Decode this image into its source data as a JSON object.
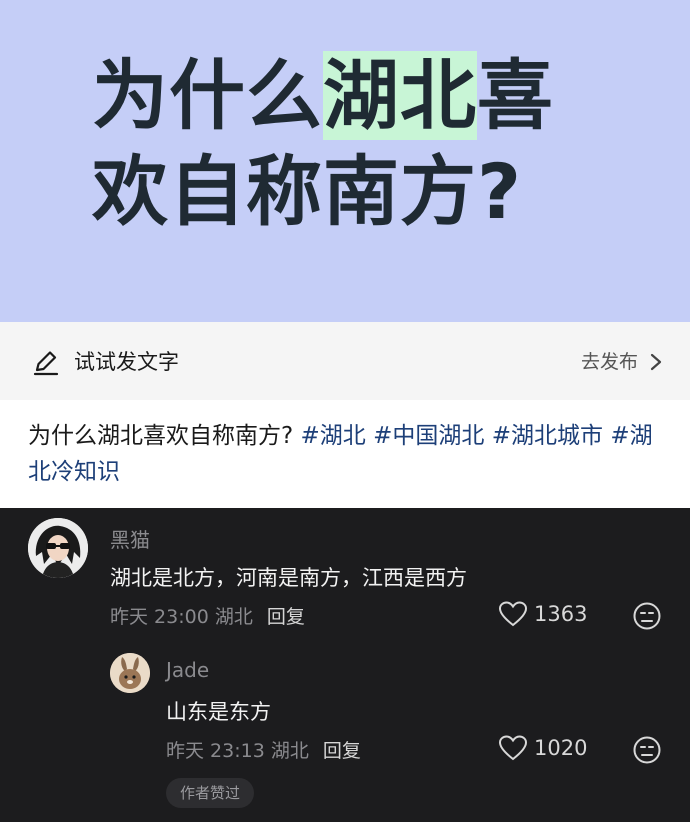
{
  "banner": {
    "title_part1": "为什么",
    "title_highlight": "湖北",
    "title_part2": "喜",
    "title_line2": "欢自称南方?"
  },
  "compose": {
    "label": "试试发文字",
    "publish_label": "去发布"
  },
  "post": {
    "text": "为什么湖北喜欢自称南方? ",
    "tags": [
      "#湖北",
      "#中国湖北",
      "#湖北城市",
      "#湖北冷知识"
    ]
  },
  "comments": [
    {
      "username": "黑猫",
      "text": "湖北是北方，河南是南方，江西是西方",
      "meta": "昨天 23:00 湖北",
      "reply_label": "回复",
      "likes": "1363"
    },
    {
      "username": "Jade",
      "text": "山东是东方",
      "meta": "昨天 23:13 湖北",
      "reply_label": "回复",
      "likes": "1020",
      "badge": "作者赞过"
    }
  ],
  "colors": {
    "banner_bg": "#c5cef7",
    "highlight": "#c8f5d6",
    "tag_color": "#1d3f78",
    "comments_bg": "#1c1c1e"
  }
}
